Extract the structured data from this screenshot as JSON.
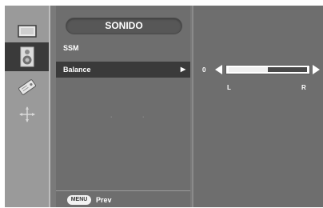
{
  "sidebar": {
    "icons": [
      {
        "name": "picture-icon",
        "active": false
      },
      {
        "name": "speaker-icon",
        "active": true
      },
      {
        "name": "tag-icon",
        "active": false
      },
      {
        "name": "adjust-icon",
        "active": false
      }
    ]
  },
  "menu": {
    "title": "SONIDO",
    "items": [
      {
        "label": "SSM",
        "selected": false
      },
      {
        "label": "Balance",
        "selected": true
      }
    ]
  },
  "footer": {
    "menu_key": "MENU",
    "prev_label": "Prev"
  },
  "balance": {
    "value": "0",
    "level_fraction": 0.5,
    "left_label": "L",
    "right_label": "R"
  },
  "colors": {
    "panel": "#6e6e6e",
    "selected": "#3a3a3a",
    "text": "#ffffff"
  }
}
